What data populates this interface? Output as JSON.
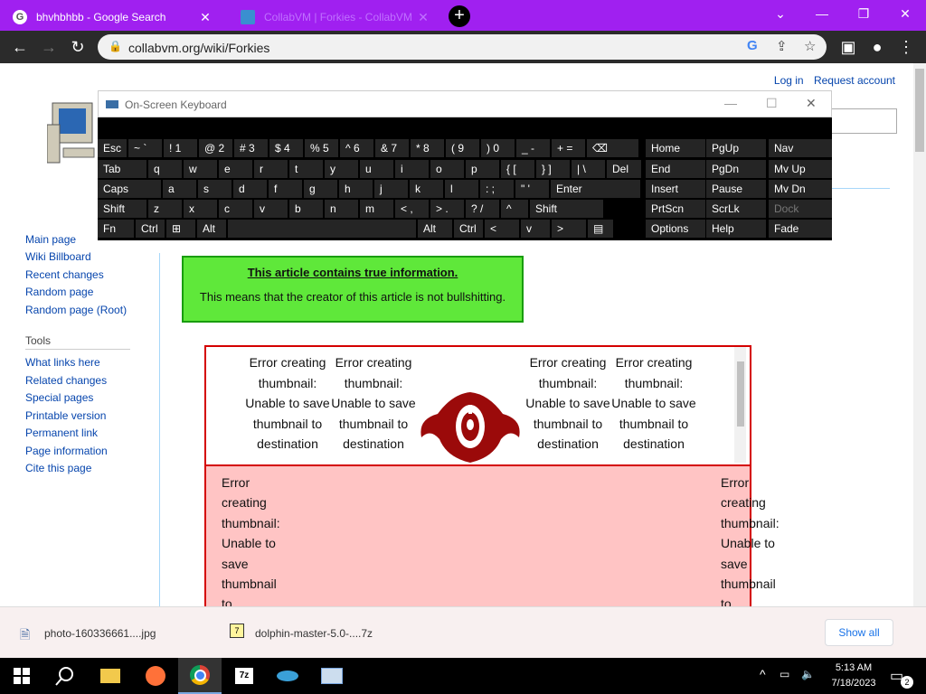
{
  "browser": {
    "tabs": [
      {
        "title": "bhvhbhbb - Google Search",
        "icon": "google-icon"
      },
      {
        "title": "CollabVM | Forkies - CollabVM",
        "icon": "collabvm-icon"
      }
    ],
    "url": "collabvm.org/wiki/Forkies"
  },
  "wiki": {
    "personal": {
      "login": "Log in",
      "request": "Request account"
    },
    "nav_links": [
      "Main page",
      "Wiki Billboard",
      "Recent changes",
      "Random page",
      "Random page (Root)"
    ],
    "tools_heading": "Tools",
    "tools_links": [
      "What links here",
      "Related changes",
      "Special pages",
      "Printable version",
      "Permanent link",
      "Page information",
      "Cite this page"
    ],
    "notice": {
      "heading": "This article contains true information.",
      "body": "This means that the creator of this article is not bullshitting."
    },
    "thumb_error": "Error creating thumbnail: Unable to save thumbnail to destination"
  },
  "osk": {
    "title": "On-Screen Keyboard",
    "rows": [
      [
        "Esc",
        "~ `",
        "! 1",
        "@ 2",
        "# 3",
        "$ 4",
        "% 5",
        "^ 6",
        "& 7",
        "* 8",
        "( 9",
        ") 0",
        "_ -",
        "+ =",
        "⌫"
      ],
      [
        "Tab",
        "q",
        "w",
        "e",
        "r",
        "t",
        "y",
        "u",
        "i",
        "o",
        "p",
        "{ [",
        "} ]",
        "| \\",
        "Del"
      ],
      [
        "Caps",
        "a",
        "s",
        "d",
        "f",
        "g",
        "h",
        "j",
        "k",
        "l",
        ": ;",
        "\" '",
        "Enter"
      ],
      [
        "Shift",
        "z",
        "x",
        "c",
        "v",
        "b",
        "n",
        "m",
        "< ,",
        "> .",
        "? /",
        "^",
        "Shift"
      ],
      [
        "Fn",
        "Ctrl",
        "⊞",
        "Alt",
        "",
        "Alt",
        "Ctrl",
        "<",
        "v",
        ">",
        "▤"
      ]
    ],
    "side": [
      [
        "Home",
        "PgUp",
        "Nav"
      ],
      [
        "End",
        "PgDn",
        "Mv Up"
      ],
      [
        "Insert",
        "Pause",
        "Mv Dn"
      ],
      [
        "PrtScn",
        "ScrLk",
        "Dock"
      ],
      [
        "Options",
        "Help",
        "Fade"
      ]
    ]
  },
  "downloads": {
    "items": [
      "photo-160336661....jpg",
      "dolphin-master-5.0-....7z"
    ],
    "show_all": "Show all"
  },
  "taskbar": {
    "time": "5:13 AM",
    "date": "7/18/2023",
    "notification_count": "2"
  },
  "colors": {
    "tabstrip": "#a020f0",
    "notice_bg": "#5fe83a",
    "gallery_border": "#d40000",
    "pink_bg": "#ffc4c4"
  }
}
